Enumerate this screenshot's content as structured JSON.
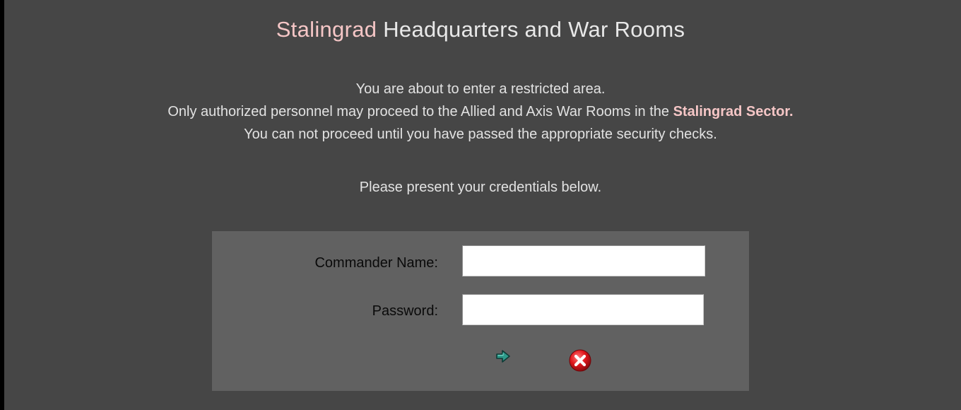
{
  "header": {
    "title_accent": "Stalingrad",
    "title_rest": " Headquarters and War Rooms"
  },
  "intro": {
    "line1": "You are about to enter a restricted area.",
    "line2_prefix": "Only authorized personnel may proceed to the Allied and Axis War Rooms in the ",
    "line2_emphasis": "Stalingrad Sector.",
    "line3": "You can not proceed until you have passed the appropriate security checks."
  },
  "prompt": "Please present your credentials below.",
  "login": {
    "name_label": "Commander Name:",
    "name_value": "",
    "password_label": "Password:",
    "password_value": "",
    "submit_icon": "arrow-right-icon",
    "cancel_icon": "close-circle-icon"
  },
  "colors": {
    "page_bg": "#464646",
    "box_bg": "#616161",
    "accent": "#f5c6c6",
    "submit": "#2e9a8a",
    "cancel": "#d8141b"
  }
}
